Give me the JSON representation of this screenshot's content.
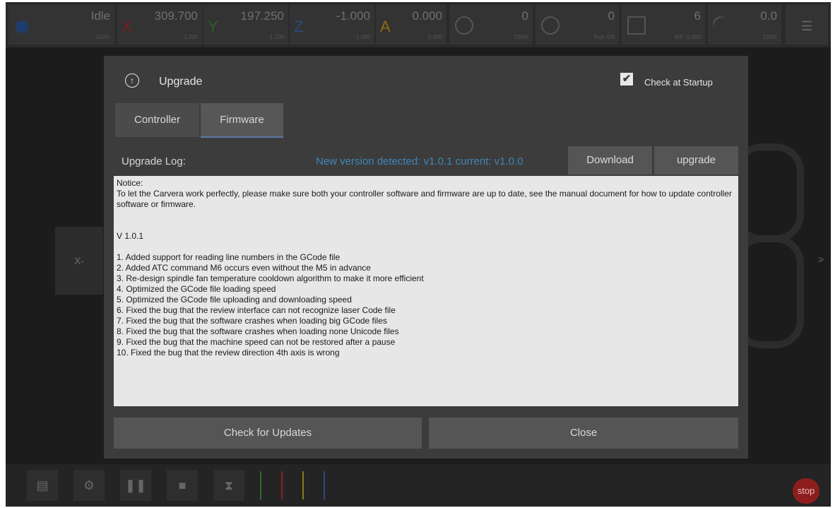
{
  "status": {
    "state": "Idle",
    "state_sub": "100%"
  },
  "axes": [
    {
      "name": "X",
      "value": "309.700",
      "sub": "-1.200",
      "color": "#7a1e1e"
    },
    {
      "name": "Y",
      "value": "197.250",
      "sub": "-1.200",
      "color": "#2f5e2b"
    },
    {
      "name": "Z",
      "value": "-1.000",
      "sub": "-1.000",
      "color": "#2a4a7a"
    },
    {
      "name": "A",
      "value": "0.000",
      "sub": "0.000",
      "color": "#8a6d14"
    }
  ],
  "indicators": [
    {
      "value": "0",
      "sub": "100%",
      "icon": "feed-icon"
    },
    {
      "value": "0",
      "sub": "Tool: 0/0",
      "icon": "spindle-icon"
    },
    {
      "value": "6",
      "sub": "WP: 0.000",
      "icon": "laser-icon"
    },
    {
      "value": "0.0",
      "sub": "100%",
      "icon": "laser-power-icon"
    }
  ],
  "background": {
    "x_minus": "X-",
    "next": ">"
  },
  "bottom": {
    "stop_label": "stop"
  },
  "dialog": {
    "title": "Upgrade",
    "check_at_startup_label": "Check at Startup",
    "check_at_startup": true,
    "tabs": [
      {
        "label": "Controller",
        "active": false
      },
      {
        "label": "Firmware",
        "active": true
      }
    ],
    "log_label": "Upgrade Log:",
    "version_text": "New version detected: v1.0.1 current: v1.0.0",
    "download_label": "Download",
    "upgrade_label": "upgrade",
    "log_text": "Notice:\nTo let the Carvera work perfectly, please make sure both your controller software and firmware are up to date, see the manual document for how to update controller software or firmware.\n\n\nV 1.0.1\n\n1. Added support for reading line numbers in the GCode file\n2. Added ATC command M6 occurs even without the M5 in advance\n3. Re-design spindle fan temperature cooldown algorithm to make it more efficient\n4. Optimized the GCode file loading speed\n5. Optimized the GCode file uploading and downloading speed\n6. Fixed the bug that the review interface can not recognize laser Code file\n7. Fixed the bug that the software crashes when loading big GCode files\n8. Fixed the bug that the software crashes when loading none Unicode files\n9. Fixed the bug that the machine speed can not be restored after a pause\n10. Fixed the bug that the review direction 4th axis is wrong",
    "check_updates_label": "Check for Updates",
    "close_label": "Close"
  }
}
